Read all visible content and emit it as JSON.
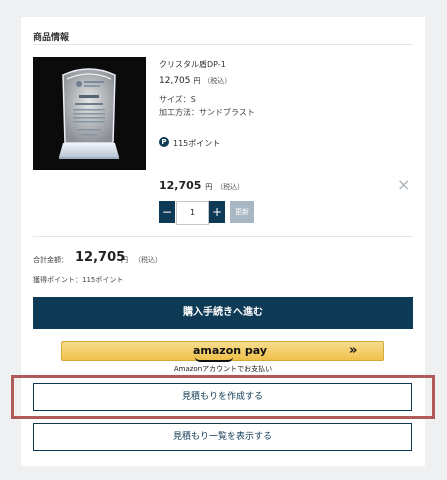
{
  "section_title": "商品情報",
  "product": {
    "name": "クリスタル盾DP-1",
    "price": "12,705",
    "yen_unit": "円",
    "tax_note": "（税込）",
    "size_line": "サイズ：S",
    "process_line": "加工方法：サンドブラスト",
    "points_badge": "P",
    "points_text": "115ポイント",
    "line_price": "12,705",
    "quantity": "1",
    "minus_label": "−",
    "plus_label": "+",
    "update_label": "更新",
    "remove_icon": "×"
  },
  "summary": {
    "total_label": "合計金額：",
    "total_amount": "12,705",
    "yen_unit": "円",
    "tax_note": "（税込）",
    "points_line": "獲得ポイント：115ポイント"
  },
  "buttons": {
    "checkout": "購入手続きへ進む",
    "amazon_logo": "amazon pay",
    "amazon_arrow": "»",
    "amazon_caption": "Amazonアカウントでお支払い",
    "create_quote": "見積もりを作成する",
    "quote_list": "見積もり一覧を表示する"
  },
  "colors": {
    "navy": "#0f3a55",
    "highlight_border": "#b15a5a",
    "amazon_yellow": "#f0c14b",
    "update_disabled": "#a9b7c2"
  },
  "icons": [
    "points-badge-icon",
    "close-icon",
    "amazon-arrow-icon"
  ]
}
